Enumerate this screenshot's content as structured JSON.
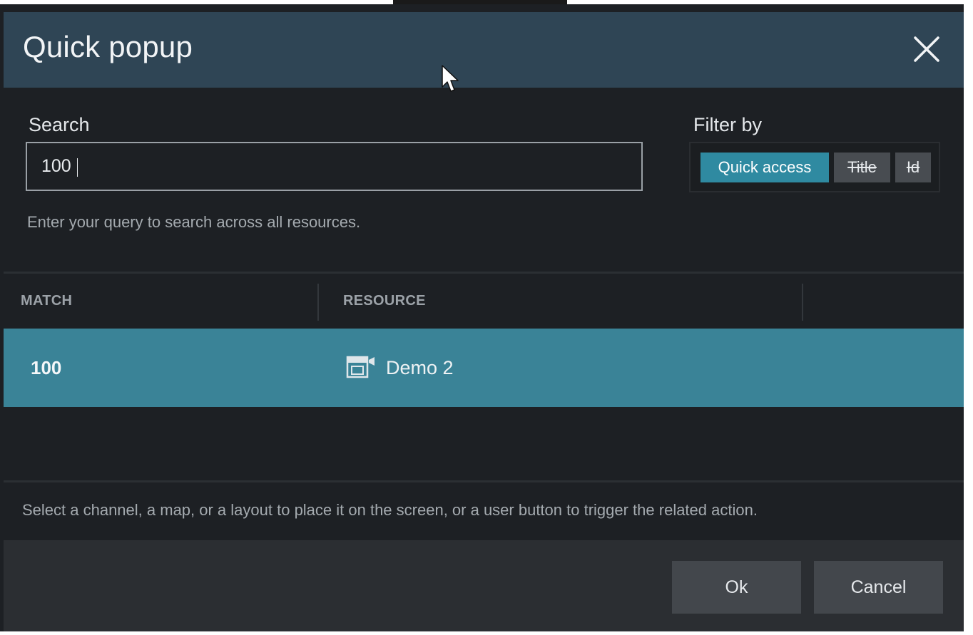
{
  "dialog": {
    "title": "Quick popup",
    "close_icon": "close-icon"
  },
  "search": {
    "label": "Search",
    "value": "100",
    "hint": "Enter your query to search across all resources."
  },
  "filter": {
    "label": "Filter by",
    "options": [
      {
        "label": "Quick access",
        "active": true
      },
      {
        "label": "Title",
        "active": false
      },
      {
        "label": "Id",
        "active": false
      }
    ]
  },
  "table": {
    "columns": [
      "MATCH",
      "RESOURCE"
    ],
    "rows": [
      {
        "match": "100",
        "resource": "Demo 2",
        "icon": "channel-camera-icon",
        "selected": true
      }
    ]
  },
  "footer": {
    "hint": "Select a channel, a map, or a layout to place it on the screen, or a user button to trigger the related action."
  },
  "actions": {
    "ok_label": "Ok",
    "cancel_label": "Cancel"
  },
  "colors": {
    "titlebar": "#2f4555",
    "accent": "#2f8aa1",
    "selected_row": "#3a8397",
    "background": "#1d2024"
  }
}
